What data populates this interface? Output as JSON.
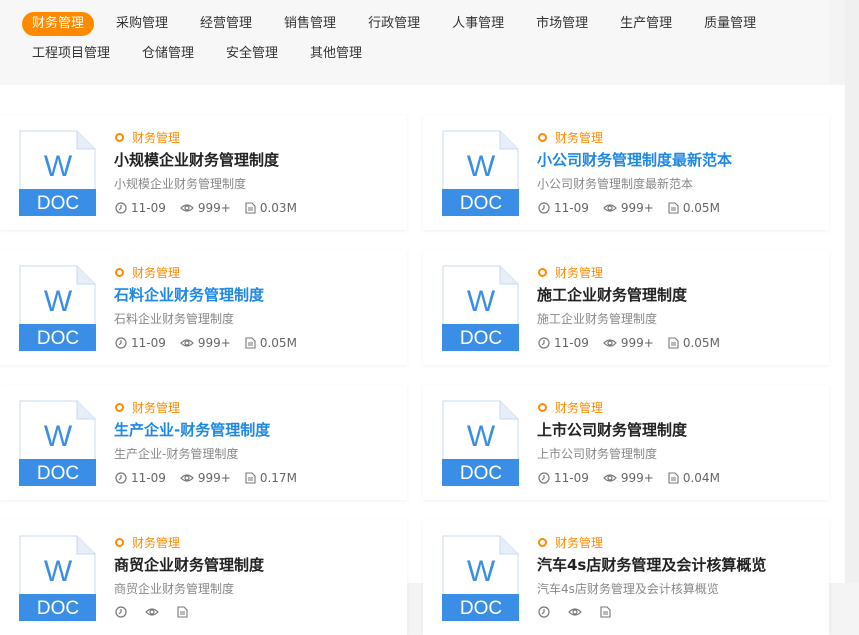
{
  "tabs": {
    "row1": [
      "财务管理",
      "采购管理",
      "经营管理",
      "销售管理",
      "行政管理",
      "人事管理",
      "市场管理",
      "生产管理",
      "质量管理"
    ],
    "row2": [
      "工程项目管理",
      "仓储管理",
      "安全管理",
      "其他管理"
    ],
    "active": "财务管理"
  },
  "icon": {
    "letter": "W",
    "ext": "DOC",
    "color": "#3a8ee6"
  },
  "cards": [
    {
      "category": "财务管理",
      "title": "小规模企业财务管理制度",
      "desc": "小规模企业财务管理制度",
      "date": "11-09",
      "views": "999+",
      "size": "0.03M"
    },
    {
      "category": "财务管理",
      "title": "小公司财务管理制度最新范本",
      "desc": "小公司财务管理制度最新范本",
      "date": "11-09",
      "views": "999+",
      "size": "0.05M"
    },
    {
      "category": "财务管理",
      "title": "石料企业财务管理制度",
      "desc": "石料企业财务管理制度",
      "date": "11-09",
      "views": "999+",
      "size": "0.05M"
    },
    {
      "category": "财务管理",
      "title": "施工企业财务管理制度",
      "desc": "施工企业财务管理制度",
      "date": "11-09",
      "views": "999+",
      "size": "0.05M"
    },
    {
      "category": "财务管理",
      "title": "生产企业-财务管理制度",
      "desc": "生产企业-财务管理制度",
      "date": "11-09",
      "views": "999+",
      "size": "0.17M"
    },
    {
      "category": "财务管理",
      "title": "上市公司财务管理制度",
      "desc": "上市公司财务管理制度",
      "date": "11-09",
      "views": "999+",
      "size": "0.04M"
    },
    {
      "category": "财务管理",
      "title": "商贸企业财务管理制度",
      "desc": "商贸企业财务管理制度",
      "date": "",
      "views": "",
      "size": ""
    },
    {
      "category": "财务管理",
      "title": "汽车4s店财务管理及会计核算概览",
      "desc": "汽车4s店财务管理及会计核算概览",
      "date": "",
      "views": "",
      "size": ""
    }
  ]
}
